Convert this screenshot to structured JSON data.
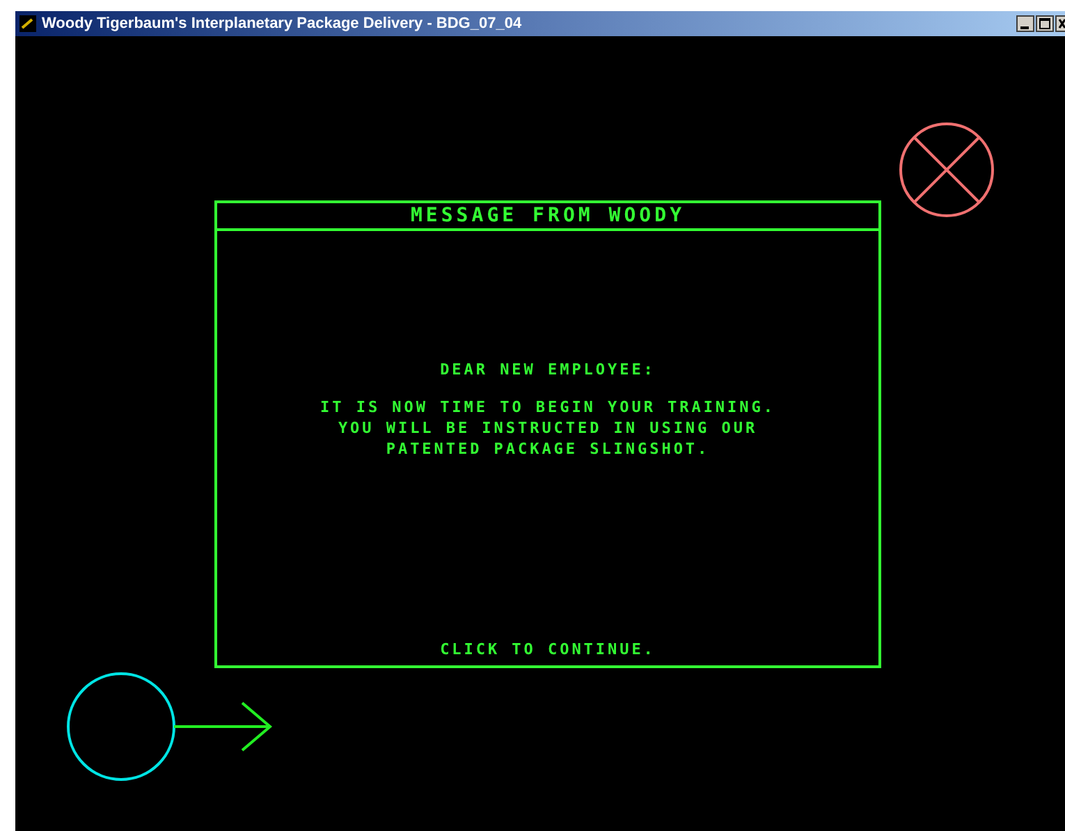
{
  "window": {
    "title": "Woody Tigerbaum's Interplanetary Package Delivery - BDG_07_04"
  },
  "dialog": {
    "title": "MESSAGE FROM WOODY",
    "greeting": "DEAR NEW EMPLOYEE:",
    "body": [
      "IT IS NOW TIME TO BEGIN YOUR TRAINING.",
      "YOU WILL BE INSTRUCTED IN USING OUR",
      "PATENTED PACKAGE SLINGSHOT."
    ],
    "footer": "CLICK TO CONTINUE."
  }
}
